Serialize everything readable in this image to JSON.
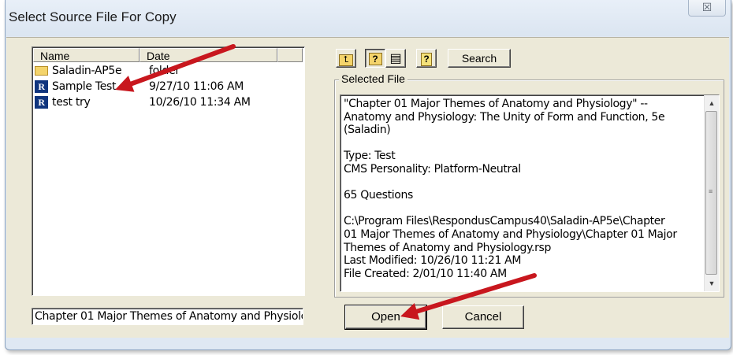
{
  "window": {
    "title": "Select Source File For Copy",
    "close_glyph": "☒"
  },
  "file_list": {
    "columns": [
      "Name",
      "Date"
    ],
    "rows": [
      {
        "icon": "folder-icon",
        "name": "Saladin-AP5e",
        "date": "folder"
      },
      {
        "icon": "respondus-file-icon",
        "name": "Sample Test",
        "date": "9/27/10  11:06 AM"
      },
      {
        "icon": "respondus-file-icon",
        "name": "test try",
        "date": "10/26/10  11:34 AM"
      }
    ],
    "r_icon_letter": "R"
  },
  "filename_field": {
    "value": "Chapter 01 Major Themes of Anatomy and Physiolc"
  },
  "toolbar": {
    "up_folder_glyph": "⮤",
    "info_view_glyph": "?",
    "list_view_glyph": "▤",
    "help_glyph": "?",
    "search_label": "Search"
  },
  "selected_file": {
    "group_label": "Selected File",
    "lines": [
      "\"Chapter 01 Major Themes of Anatomy and Physiology\" --",
      "Anatomy and Physiology: The Unity of Form and Function, 5e",
      "(Saladin)",
      "",
      "Type: Test",
      "CMS Personality: Platform-Neutral",
      "",
      "65 Questions",
      "",
      "C:\\Program Files\\RespondusCampus40\\Saladin-AP5e\\Chapter",
      "01 Major Themes of Anatomy and Physiology\\Chapter 01 Major",
      "Themes of Anatomy and Physiology.rsp",
      "Last Modified: 10/26/10  11:21 AM",
      "File Created: 2/01/10  11:40 AM"
    ]
  },
  "buttons": {
    "open_label": "Open",
    "cancel_label": "Cancel"
  },
  "annotation": {
    "arrow_color": "#c8171e"
  }
}
